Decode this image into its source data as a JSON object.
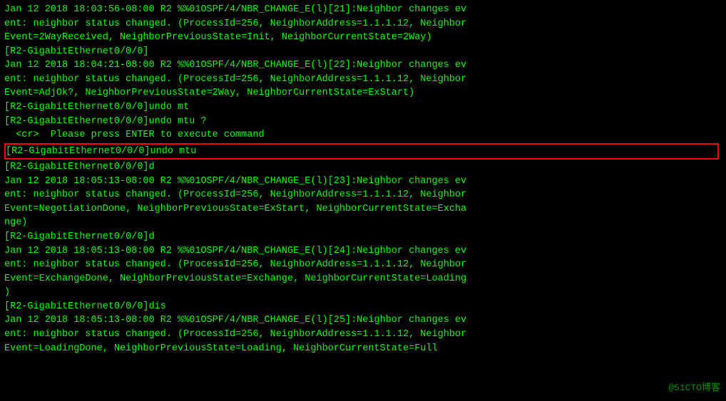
{
  "terminal": {
    "lines": [
      {
        "id": "l1",
        "text": "Jan 12 2018 18:03:56-08:00 R2 %%01OSPF/4/NBR_CHANGE_E(l)[21]:Neighbor changes ev",
        "highlight": false
      },
      {
        "id": "l2",
        "text": "ent: neighbor status changed. (ProcessId=256, NeighborAddress=1.1.1.12, Neighbor",
        "highlight": false
      },
      {
        "id": "l3",
        "text": "Event=2WayReceived, NeighborPreviousState=Init, NeighborCurrentState=2Way)",
        "highlight": false
      },
      {
        "id": "l4",
        "text": "[R2-GigabitEthernet0/0/0]",
        "highlight": false
      },
      {
        "id": "l5",
        "text": "Jan 12 2018 18:04:21-08:00 R2 %%01OSPF/4/NBR_CHANGE_E(l)[22]:Neighbor changes ev",
        "highlight": false
      },
      {
        "id": "l6",
        "text": "ent: neighbor status changed. (ProcessId=256, NeighborAddress=1.1.1.12, Neighbor",
        "highlight": false
      },
      {
        "id": "l7",
        "text": "Event=AdjOk?, NeighborPreviousState=2Way, NeighborCurrentState=ExStart)",
        "highlight": false
      },
      {
        "id": "l8",
        "text": "[R2-GigabitEthernet0/0/0]undo mt",
        "highlight": false
      },
      {
        "id": "l9",
        "text": "[R2-GigabitEthernet0/0/0]undo mtu ?",
        "highlight": false
      },
      {
        "id": "l10",
        "text": "  <cr>  Please press ENTER to execute command",
        "highlight": false
      },
      {
        "id": "l11",
        "text": "[R2-GigabitEthernet0/0/0]undo mtu ",
        "highlight": true
      },
      {
        "id": "l12",
        "text": "[R2-GigabitEthernet0/0/0]d",
        "highlight": false
      },
      {
        "id": "l13",
        "text": "Jan 12 2018 18:05:13-08:00 R2 %%01OSPF/4/NBR_CHANGE_E(l)[23]:Neighbor changes ev",
        "highlight": false
      },
      {
        "id": "l14",
        "text": "ent: neighbor status changed. (ProcessId=256, NeighborAddress=1.1.1.12, Neighbor",
        "highlight": false
      },
      {
        "id": "l15",
        "text": "Event=NegotiationDone, NeighborPreviousState=ExStart, NeighborCurrentState=Excha",
        "highlight": false
      },
      {
        "id": "l16",
        "text": "nge)",
        "highlight": false
      },
      {
        "id": "l17",
        "text": "[R2-GigabitEthernet0/0/0]d",
        "highlight": false
      },
      {
        "id": "l18",
        "text": "Jan 12 2018 18:05:13-08:00 R2 %%01OSPF/4/NBR_CHANGE_E(l)[24]:Neighbor changes ev",
        "highlight": false
      },
      {
        "id": "l19",
        "text": "ent: neighbor status changed. (ProcessId=256, NeighborAddress=1.1.1.12, Neighbor",
        "highlight": false
      },
      {
        "id": "l20",
        "text": "Event=ExchangeDone, NeighborPreviousState=Exchange, NeighborCurrentState=Loading",
        "highlight": false
      },
      {
        "id": "l21",
        "text": ")",
        "highlight": false
      },
      {
        "id": "l22",
        "text": "[R2-GigabitEthernet0/0/0]dis",
        "highlight": false
      },
      {
        "id": "l23",
        "text": "Jan 12 2018 18:05:13-08:00 R2 %%01OSPF/4/NBR_CHANGE_E(l)[25]:Neighbor changes ev",
        "highlight": false
      },
      {
        "id": "l24",
        "text": "ent: neighbor status changed. (ProcessId=256, NeighborAddress=1.1.1.12, Neighbor",
        "highlight": false
      },
      {
        "id": "l25",
        "text": "Event=LoadingDone, NeighborPreviousState=Loading, NeighborCurrentState=Full",
        "highlight": false
      }
    ],
    "watermark": "@51CTO博客"
  }
}
